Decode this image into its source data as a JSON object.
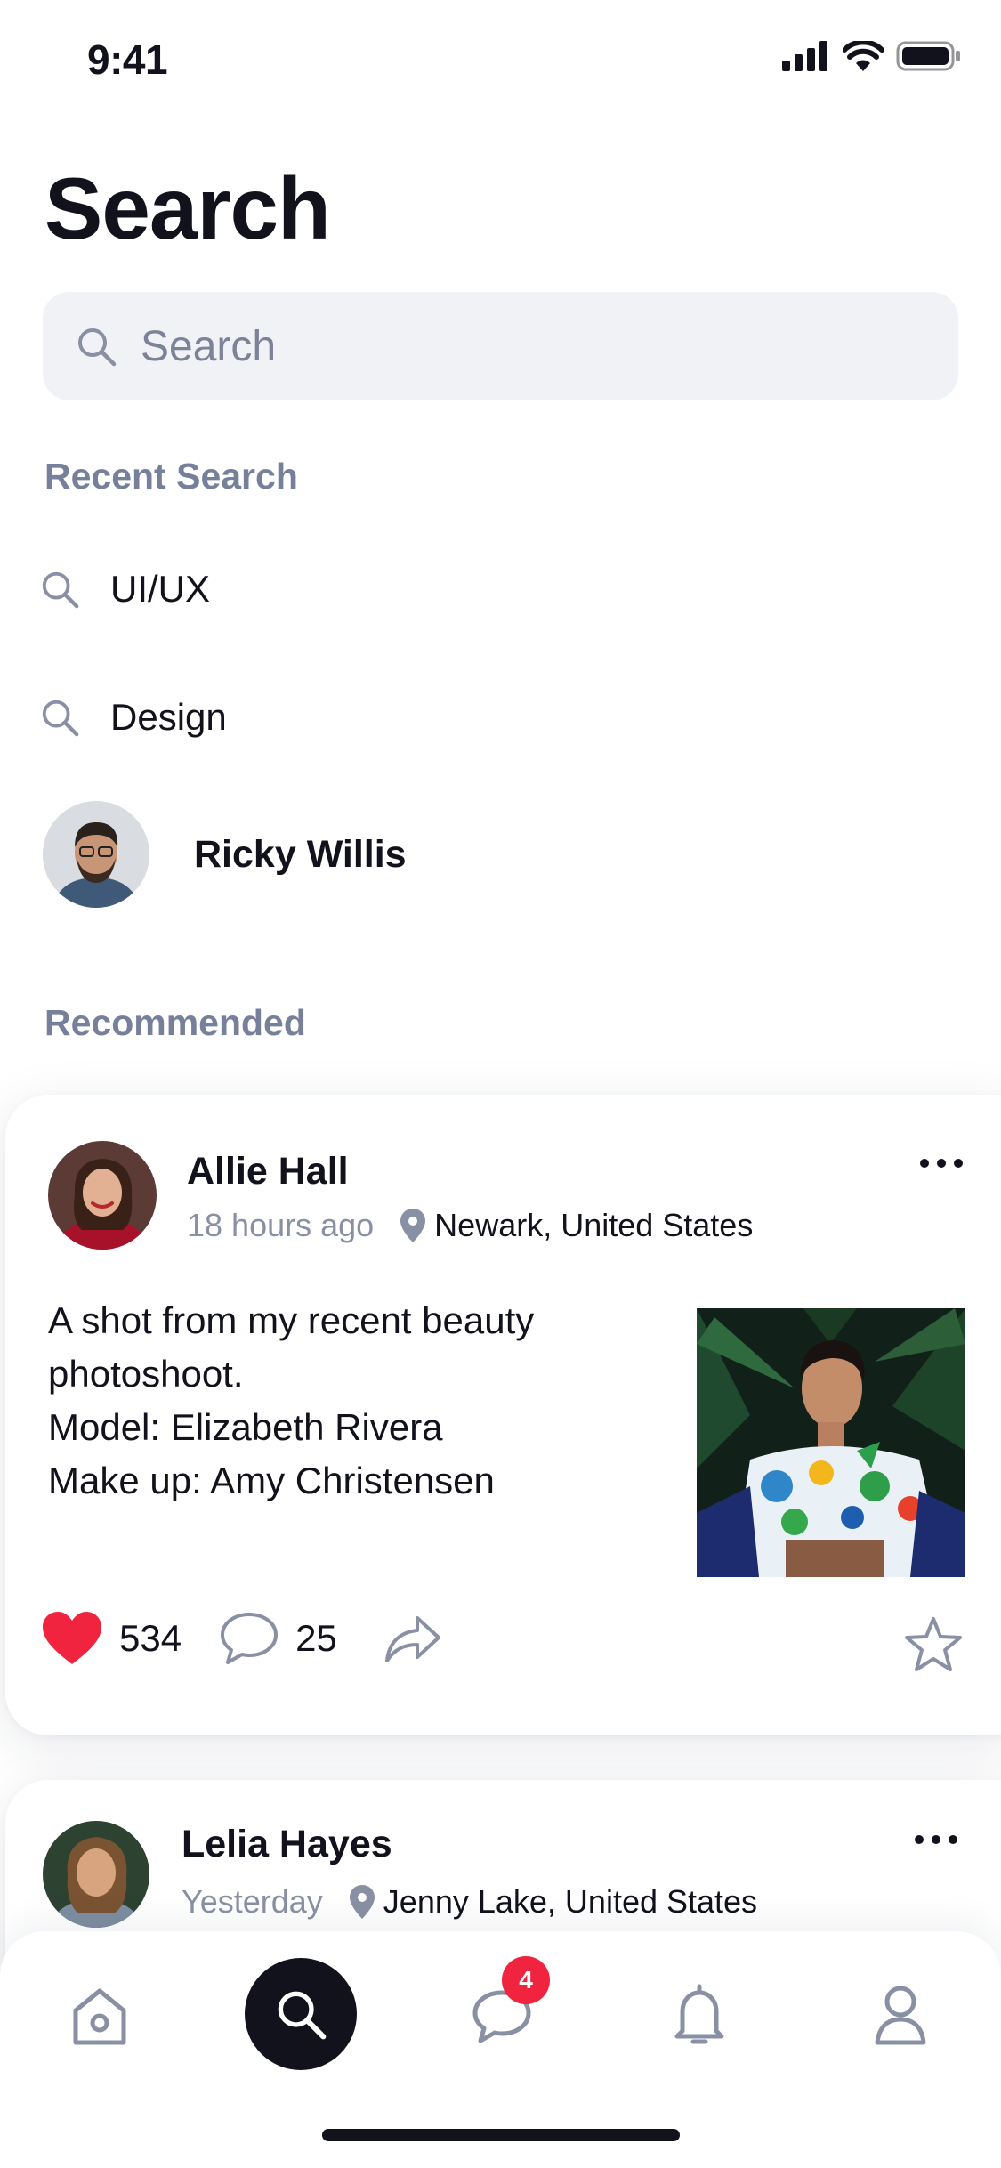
{
  "status_bar": {
    "time": "9:41"
  },
  "header": {
    "title": "Search"
  },
  "search": {
    "placeholder": "Search",
    "value": ""
  },
  "recent": {
    "label": "Recent Search",
    "queries": [
      "UI/UX",
      "Design"
    ],
    "person": {
      "name": "Ricky Willis"
    }
  },
  "recommended": {
    "label": "Recommended"
  },
  "posts": [
    {
      "author": "Allie Hall",
      "time": "18 hours ago",
      "location": "Newark, United States",
      "text_lines": [
        "A shot from my recent beauty",
        "photoshoot.",
        "Model: Elizabeth Rivera",
        "Make up: Amy Christensen"
      ],
      "likes": "534",
      "comments": "25"
    },
    {
      "author": "Lelia Hayes",
      "time": "Yesterday",
      "location": "Jenny Lake, United States"
    }
  ],
  "tabbar": {
    "items": [
      "home-icon",
      "search-icon",
      "chat-icon",
      "bell-icon",
      "profile-icon"
    ],
    "active": "search",
    "messages_badge": "4"
  },
  "colors": {
    "text": "#12121d",
    "muted": "#76809a",
    "search_bg": "#f1f2f6",
    "like": "#f0243f",
    "icon_gray": "#8a90a4",
    "active_tab_bg": "#12121d"
  }
}
